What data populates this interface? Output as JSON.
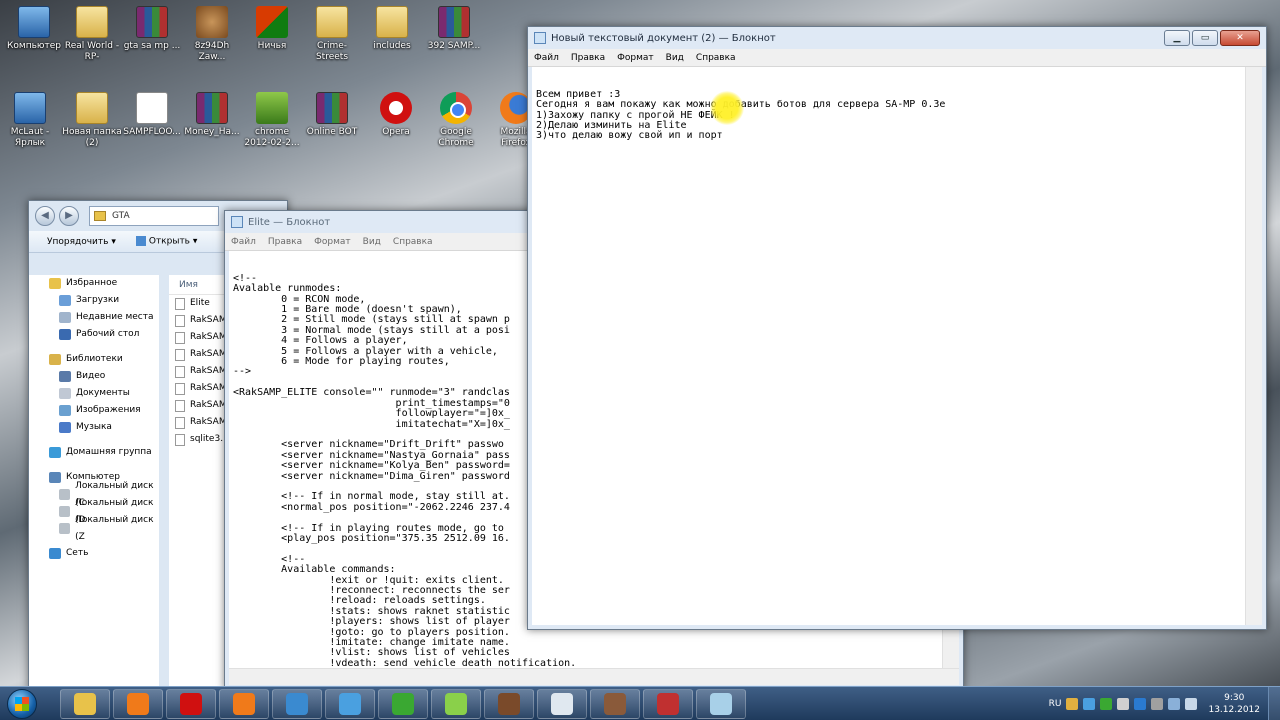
{
  "desktop": {
    "icons": [
      {
        "label": "Компьютер",
        "kind": "pc"
      },
      {
        "label": "Real World -RP-",
        "kind": "folder"
      },
      {
        "label": "gta sa mp ...",
        "kind": "winrar"
      },
      {
        "label": "8z94Dh Zaw...",
        "kind": "bear"
      },
      {
        "label": "Ничья",
        "kind": "ms"
      },
      {
        "label": "Crime-Streets",
        "kind": "folder"
      },
      {
        "label": "includes",
        "kind": "folder"
      },
      {
        "label": "392 SAMP...",
        "kind": "winrar"
      },
      {
        "label": "McLaut - Ярлык",
        "kind": "pc"
      },
      {
        "label": "Новая папка (2)",
        "kind": "folder"
      },
      {
        "label": "SAMPFLOO...",
        "kind": "doc"
      },
      {
        "label": "Money_Ha...",
        "kind": "winrar"
      },
      {
        "label": "chrome 2012-02-2...",
        "kind": "green"
      },
      {
        "label": "Online BOT",
        "kind": "winrar"
      },
      {
        "label": "Opera",
        "kind": "opera"
      },
      {
        "label": "Google Chrome",
        "kind": "chrome"
      },
      {
        "label": "Mozilla Firefox",
        "kind": "firefox"
      }
    ]
  },
  "notepad_main": {
    "title": "Новый текстовый документ (2) — Блокнот",
    "menu": [
      "Файл",
      "Правка",
      "Формат",
      "Вид",
      "Справка"
    ],
    "content": "Всем привет :3\nСегодня я вам покажу как можно добавить ботов для сервера SA-MP 0.3e\n1)Захожу папку с прогой НЕ ФЕЙК !\n2)Делаю изминить на Elite\n3)что делаю вожу свой ип и порт"
  },
  "notepad_elite": {
    "title": "Elite — Блокнот",
    "menu": [
      "Файл",
      "Правка",
      "Формат",
      "Вид",
      "Справка"
    ],
    "content": "<!--\nAvalable runmodes:\n        0 = RCON mode,\n        1 = Bare mode (doesn't spawn),\n        2 = Still mode (stays still at spawn p\n        3 = Normal mode (stays still at a posi\n        4 = Follows a player,\n        5 = Follows a player with a vehicle,\n        6 = Mode for playing routes,\n-->\n\n<RakSAMP_ELITE console=\"\" runmode=\"3\" randclas\n                           print_timestamps=\"0\n                           followplayer=\"=]0x_\n                           imitatechat=\"X=]0x_\n\n        <server nickname=\"Drift_Drift\" passwo\n        <server nickname=\"Nastya_Gornaia\" pass\n        <server nickname=\"Kolya_Ben\" password=\n        <server nickname=\"Dima_Giren\" password\n\n        <!-- If in normal mode, stay still at.\n        <normal_pos position=\"-2062.2246 237.4\n\n        <!-- If in playing routes mode, go to\n        <play_pos position=\"375.35 2512.09 16.\n\n        <!--\n        Available commands:\n                !exit or !quit: exits client.\n                !reconnect: reconnects the ser\n                !reload: reloads settings.\n                !stats: shows raknet statistic\n                !players: shows list of player\n                !goto: go to players position.\n                !imitate: change imitate name.\n                !vlist: shows list of vehicles\n                !vdeath: send vehicle death notification.\n                !selveh: selects vehicle for playback.\n                !rtlist: shows list of routes."
  },
  "explorer": {
    "address": "GTA",
    "toolbar": {
      "organize": "Упорядочить",
      "open": "Открыть"
    },
    "column_header": "Имя",
    "sidebar": [
      {
        "label": "Избранное",
        "level": 0,
        "color": "#e8c24a"
      },
      {
        "label": "Загрузки",
        "level": 1,
        "color": "#6a9ed8"
      },
      {
        "label": "Недавние места",
        "level": 1,
        "color": "#a0b4cc"
      },
      {
        "label": "Рабочий стол",
        "level": 1,
        "color": "#3a6ab0"
      },
      {
        "label": "",
        "level": -1,
        "color": ""
      },
      {
        "label": "Библиотеки",
        "level": 0,
        "color": "#d9b24a"
      },
      {
        "label": "Видео",
        "level": 1,
        "color": "#5a7aa8"
      },
      {
        "label": "Документы",
        "level": 1,
        "color": "#c0c8d4"
      },
      {
        "label": "Изображения",
        "level": 1,
        "color": "#6aa0d0"
      },
      {
        "label": "Музыка",
        "level": 1,
        "color": "#4a7ac8"
      },
      {
        "label": "",
        "level": -1,
        "color": ""
      },
      {
        "label": "Домашняя группа",
        "level": 0,
        "color": "#3a9ad8"
      },
      {
        "label": "",
        "level": -1,
        "color": ""
      },
      {
        "label": "Компьютер",
        "level": 0,
        "color": "#5a86b8"
      },
      {
        "label": "Локальный диск (C",
        "level": 1,
        "color": "#b8c0c8"
      },
      {
        "label": "Локальный диск (D",
        "level": 1,
        "color": "#b8c0c8"
      },
      {
        "label": "Локальный диск (Z",
        "level": 1,
        "color": "#b8c0c8"
      },
      {
        "label": "",
        "level": -1,
        "color": ""
      },
      {
        "label": "Сеть",
        "level": 0,
        "color": "#3a8ad0"
      }
    ],
    "files": [
      "Elite",
      "RakSAM",
      "RakSAM",
      "RakSAM",
      "RakSAM",
      "RakSAM",
      "RakSAM",
      "RakSAM",
      "sqlite3."
    ]
  },
  "taskbar": {
    "apps": [
      "explorer-icon",
      "media-player-icon",
      "opera-icon",
      "firefox-icon",
      "chrome-icon",
      "skype-icon",
      "utorrent-icon",
      "icq-icon",
      "game-icon",
      "notepad-icon",
      "game2-icon",
      "app-icon",
      "notepad2-icon"
    ],
    "lang": "RU",
    "time": "9:30",
    "date": "13.12.2012"
  },
  "colors": {
    "highlight": "#fff028",
    "taskbar": "#2a4a70"
  }
}
